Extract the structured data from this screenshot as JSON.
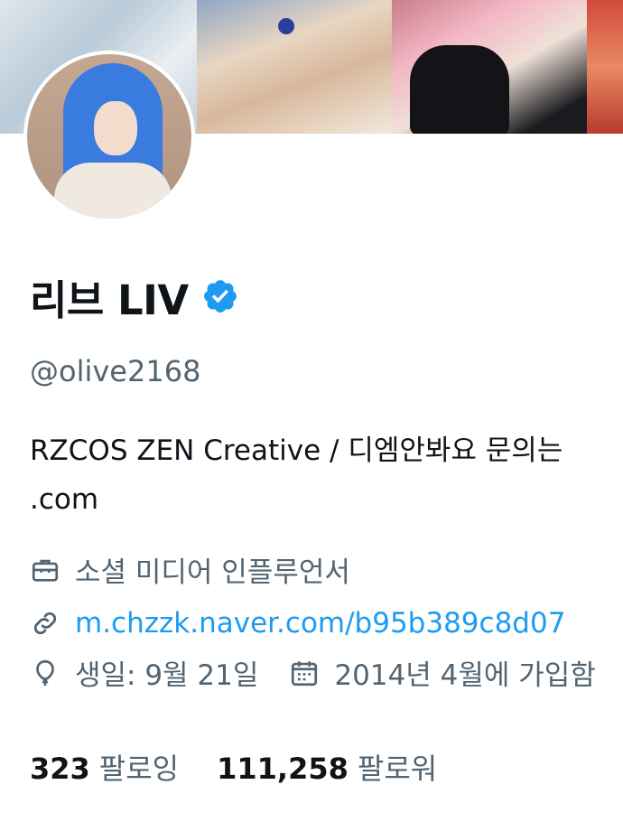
{
  "profile": {
    "display_name": "리브 LIV",
    "handle": "@olive2168",
    "bio_line1": "RZCOS ZEN Creative / 디엠안봐요 문의는",
    "bio_line2": ".com",
    "category": "소셜 미디어 인플루언서",
    "link": "m.chzzk.naver.com/b95b389c8d07",
    "birthday": "생일: 9월 21일",
    "joined": "2014년 4월에 가입함",
    "following_count": "323",
    "following_label": "팔로잉",
    "followers_count": "111,258",
    "followers_label": "팔로워"
  },
  "icons": {
    "verified": "verified-badge-icon",
    "category": "briefcase-icon",
    "link": "link-icon",
    "birthday": "balloon-icon",
    "joined": "calendar-icon"
  },
  "colors": {
    "verified": "#1d9bf0",
    "link": "#1d9bf0",
    "secondary_text": "#536471",
    "primary_text": "#0f1419"
  }
}
